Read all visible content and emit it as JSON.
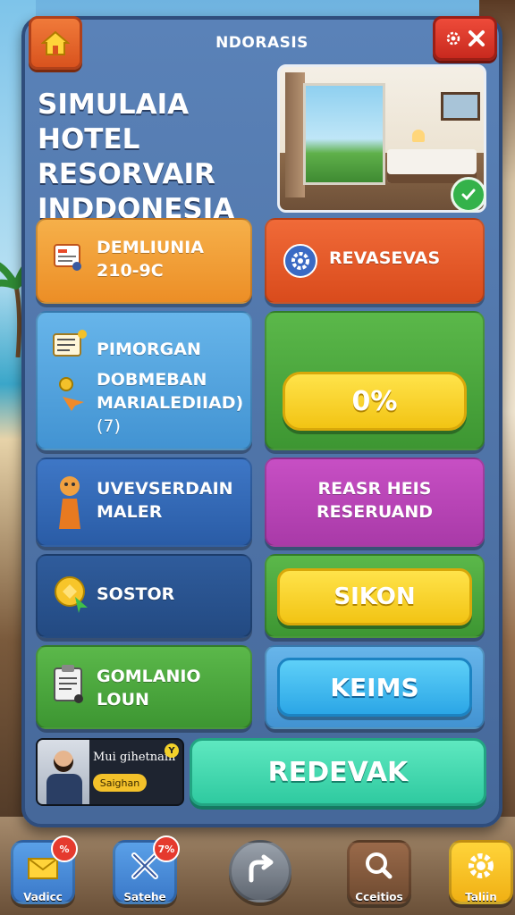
{
  "header": {
    "title": "NDORASIS",
    "main_title_lines": [
      "SIMULAIA HOTEL",
      "RESORVAIR",
      "INDDONESIA"
    ]
  },
  "tiles": {
    "t1": {
      "line1": "DEMLIUNIA",
      "line2": "210-9C"
    },
    "t2": {
      "label": "REVASEVAS"
    },
    "t3": {
      "line1": "PIMORGAN",
      "line2": "DOBMEBAN",
      "line3": "MARIALEDIIAD)",
      "line4": "(7)"
    },
    "t4": {
      "progress_label": "0%"
    },
    "t5": {
      "line1": "UVEVSERDAIN",
      "line2": "MALER"
    },
    "t6": {
      "line1": "REASR HEIS",
      "line2": "RESERUAND"
    },
    "t7": {
      "label": "SOSTOR"
    },
    "t8": {
      "button": "SIKON"
    },
    "t9": {
      "line1": "GOMLANIO",
      "line2": "LOUN"
    },
    "t10": {
      "button": "KEIMS"
    }
  },
  "promo": {
    "text": "Mui gihetnain",
    "button": "Saighan",
    "corner": "Y"
  },
  "primary_button": "REDEVAK",
  "dock": [
    {
      "label": "Vadicc",
      "badge": "%",
      "icon": "mail-icon"
    },
    {
      "label": "Satehe",
      "badge": "7%",
      "icon": "tools-icon"
    },
    {
      "label": "",
      "icon": "arrow-icon"
    },
    {
      "label": "Cceitios",
      "icon": "search-icon"
    },
    {
      "label": "Taliin",
      "icon": "gear-icon"
    }
  ]
}
